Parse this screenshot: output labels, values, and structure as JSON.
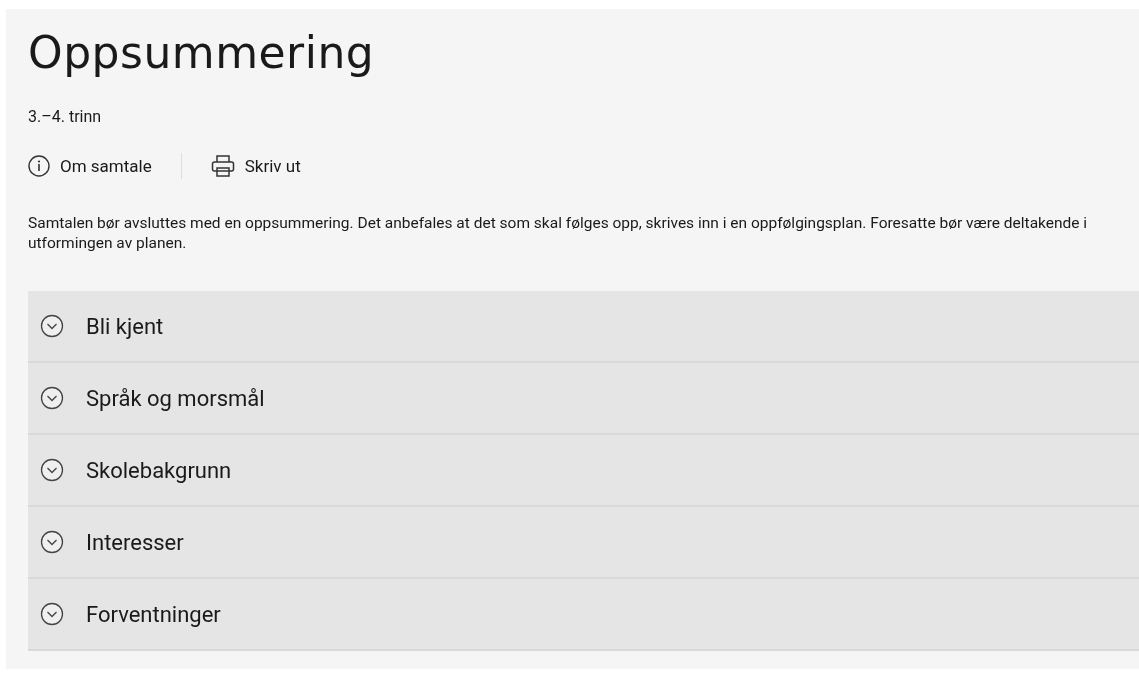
{
  "title": "Oppsummering",
  "subtitle": "3.–4. trinn",
  "actions": [
    {
      "kind": "info",
      "label": "Om samtale"
    },
    {
      "kind": "print",
      "label": "Skriv ut"
    }
  ],
  "intro": "Samtalen bør avsluttes med en oppsummering. Det anbefales at det som skal følges opp, skrives inn i en oppfølgingsplan. Foresatte bør være deltakende i utformingen av planen.",
  "sections": [
    {
      "label": "Bli kjent",
      "expanded": false
    },
    {
      "label": "Språk og morsmål",
      "expanded": false
    },
    {
      "label": "Skolebakgrunn",
      "expanded": false
    },
    {
      "label": "Interesser",
      "expanded": false
    },
    {
      "label": "Forventninger",
      "expanded": false
    }
  ]
}
